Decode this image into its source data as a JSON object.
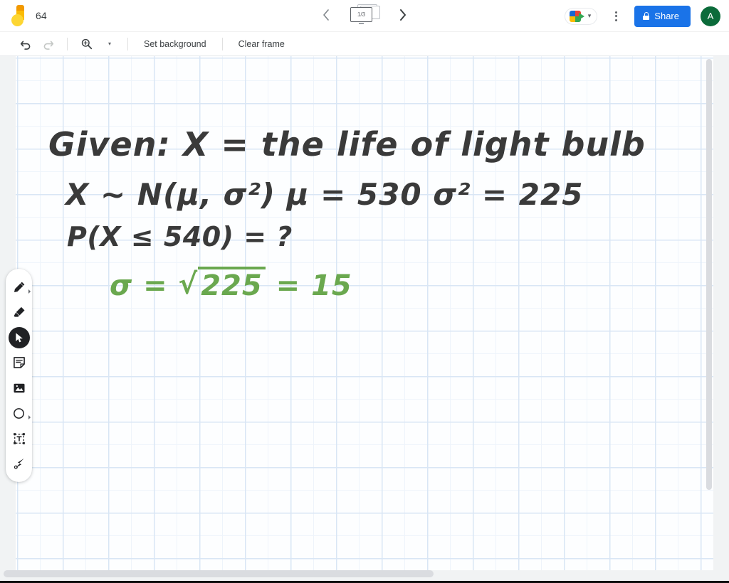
{
  "app": {
    "name": "Jamboard",
    "logo_icon": "jamboard-logo"
  },
  "header": {
    "title": "64",
    "prev_icon": "chevron-left-icon",
    "next_icon": "chevron-right-icon",
    "frame_counter": "1/3",
    "frame_icon": "frame-stack-icon",
    "meet_icon": "google-meet-camera-icon",
    "meet_caret": "▾",
    "more_icon": "kebab-menu-icon",
    "share_label": "Share",
    "share_lock_icon": "lock-icon",
    "avatar_initial": "A"
  },
  "toolbar": {
    "undo_icon": "undo-icon",
    "redo_icon": "redo-icon",
    "zoom_icon": "zoom-magnifier-icon",
    "zoom_caret": "▾",
    "set_background_label": "Set background",
    "clear_frame_label": "Clear frame"
  },
  "tools": [
    {
      "name": "pen",
      "icon": "pen-icon",
      "active": false,
      "has_caret": true
    },
    {
      "name": "eraser",
      "icon": "eraser-icon",
      "active": false,
      "has_caret": false
    },
    {
      "name": "select",
      "icon": "cursor-select-icon",
      "active": true,
      "has_caret": false
    },
    {
      "name": "sticky-note",
      "icon": "sticky-note-icon",
      "active": false,
      "has_caret": false
    },
    {
      "name": "image",
      "icon": "image-icon",
      "active": false,
      "has_caret": false
    },
    {
      "name": "shape",
      "icon": "circle-shape-icon",
      "active": false,
      "has_caret": true
    },
    {
      "name": "text-box",
      "icon": "text-box-icon",
      "active": false,
      "has_caret": false
    },
    {
      "name": "laser-pointer",
      "icon": "laser-pointer-icon",
      "active": false,
      "has_caret": false
    }
  ],
  "canvas": {
    "background": "graph-paper-grid",
    "grid_color": "#d9e6f5",
    "paper_color": "#fdfeff",
    "ink_color": "#3a3a3a",
    "accent_green": "#6aa84f",
    "handwriting": {
      "line1": "Given:  X = the life of light bulb",
      "line2": "X ~ N(μ, σ²)     μ = 530        σ² = 225",
      "line3": "P(X ≤ 540) = ?",
      "line4_prefix": "σ = ",
      "line4_radicand": "225",
      "line4_suffix": " = 15"
    }
  },
  "scrollbars": {
    "horizontal_icon": "horizontal-scrollbar",
    "vertical_icon": "vertical-scrollbar"
  }
}
